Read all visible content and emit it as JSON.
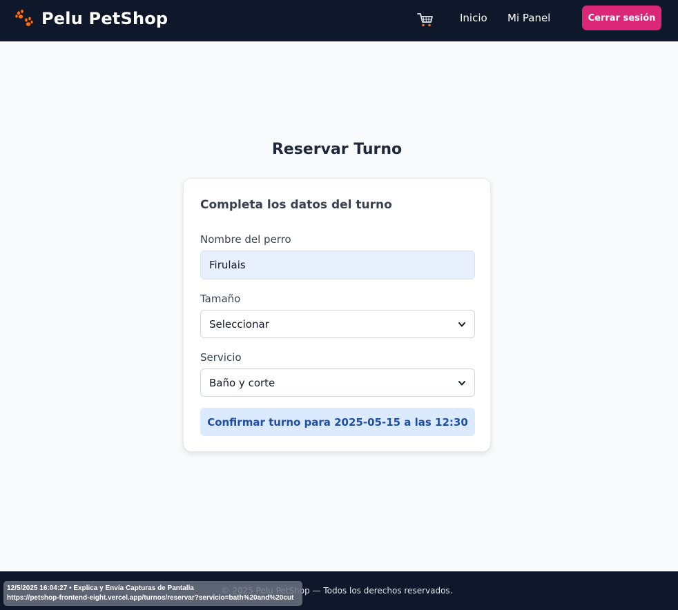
{
  "header": {
    "brand_name": "Pelu PetShop",
    "brand_icon": "paw-icon",
    "cart_icon": "cart-icon",
    "nav": [
      "Inicio",
      "Mi Panel"
    ],
    "logout_label": "Cerrar sesión"
  },
  "main": {
    "title": "Reservar Turno",
    "card_subtitle": "Completa los datos del turno",
    "fields": {
      "dog_name": {
        "label": "Nombre del perro",
        "value": "Firulais"
      },
      "size": {
        "label": "Tamaño",
        "selected": "Seleccionar"
      },
      "service": {
        "label": "Servicio",
        "selected": "Baño y corte"
      }
    },
    "confirm_label": "Confirmar turno para 2025-05-15 a las 12:30"
  },
  "footer": {
    "text": "© 2025 Pelu PetShop — Todos los derechos reservados."
  },
  "capture_overlay": {
    "line1": "12/5/2025 16:04:27 • Explica y Envía Capturas de Pantalla",
    "line2": "https://petshop-frontend-eight.vercel.app/turnos/reservar?servicio=bath%20and%20cut"
  },
  "colors": {
    "navbar": "#0f172a",
    "accent_button": "#db2777",
    "confirm_bg": "#dbeafe",
    "confirm_text": "#1e4fa8",
    "page_bg": "#f8fafc"
  }
}
